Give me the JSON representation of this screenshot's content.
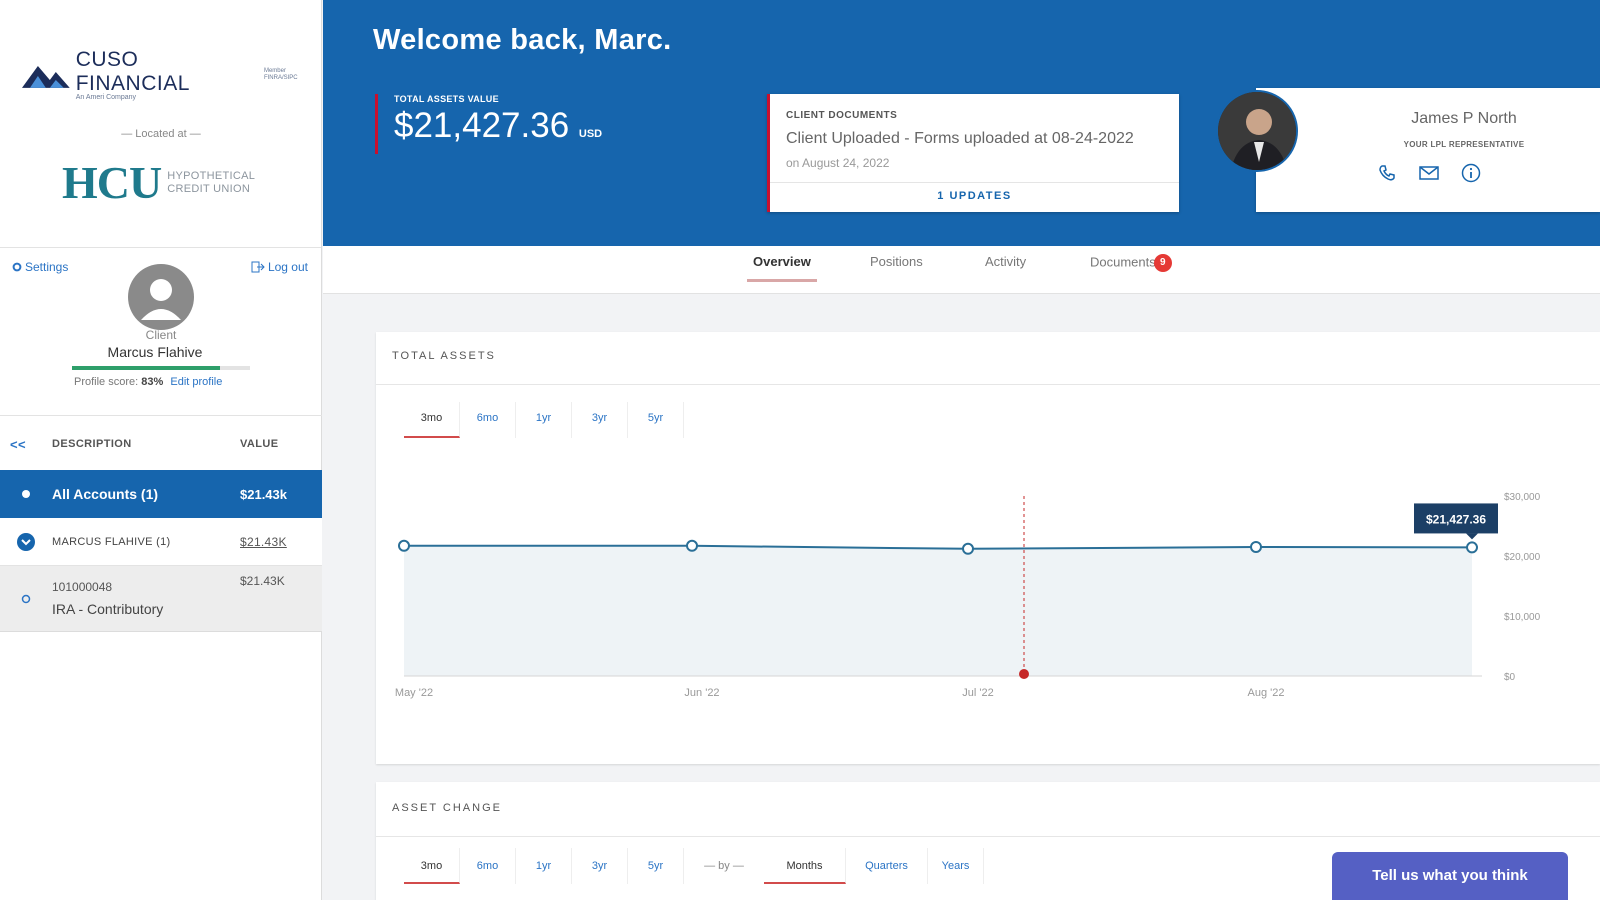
{
  "sidebar": {
    "brand": {
      "name": "CUSO FINANCIAL",
      "sub": "An Ameri Company",
      "side": "Member FINRA/SIPC"
    },
    "located_at": "— Located at —",
    "hcu": {
      "text": "HCU",
      "side_line1": "HYPOTHETICAL",
      "side_line2": "CREDIT UNION"
    },
    "settings_label": "Settings",
    "logout_label": "Log out",
    "profile": {
      "role": "Client",
      "name": "Marcus Flahive",
      "score_label": "Profile score:",
      "score_value": "83%",
      "score_fraction": 0.83,
      "edit_label": "Edit profile"
    },
    "accounts_header": {
      "collapse": "<<",
      "description": "DESCRIPTION",
      "value": "VALUE"
    },
    "accounts": [
      {
        "description": "All Accounts (1)",
        "value": "$21.43k"
      },
      {
        "description": "MARCUS FLAHIVE (1)",
        "value": "$21.43K"
      },
      {
        "number": "101000048",
        "description": "IRA - Contributory",
        "value": "$21.43K"
      }
    ]
  },
  "header": {
    "welcome": "Welcome back, Marc.",
    "total_assets_label": "TOTAL ASSETS VALUE",
    "total_assets_value": "$21,427.36",
    "currency": "USD",
    "client_documents": {
      "label": "CLIENT DOCUMENTS",
      "title": "Client Uploaded - Forms uploaded at 08-24-2022",
      "date": "on August 24, 2022",
      "updates": "1 UPDATES"
    },
    "representative": {
      "name": "James P North",
      "role": "YOUR LPL REPRESENTATIVE",
      "icons": [
        "phone-icon",
        "mail-icon",
        "info-icon"
      ]
    }
  },
  "tabs": [
    {
      "label": "Overview",
      "active": true
    },
    {
      "label": "Positions"
    },
    {
      "label": "Activity"
    },
    {
      "label": "Documents",
      "badge": "9"
    }
  ],
  "total_assets": {
    "title": "TOTAL ASSETS",
    "ranges": [
      "3mo",
      "6mo",
      "1yr",
      "3yr",
      "5yr"
    ],
    "active_range": "3mo",
    "tooltip": "$21,427.36"
  },
  "chart_data": {
    "type": "area",
    "title": "TOTAL ASSETS",
    "x": [
      "May '22",
      "Jun '22",
      "Jul '22",
      "Aug '22",
      "Aug '22 end"
    ],
    "x_tick_labels": [
      "May '22",
      "Jun '22",
      "Jul '22",
      "Aug '22"
    ],
    "values": [
      21700,
      21700,
      21200,
      21500,
      21427.36
    ],
    "y_ticks": [
      "$30,000",
      "$20,000",
      "$10,000",
      "$0"
    ],
    "ylim": [
      0,
      30000
    ],
    "marker_event": {
      "position": "between Jul '22 and Aug '22",
      "color": "#c62828"
    },
    "grid": false,
    "colors": {
      "line": "#2a6f97",
      "fill": "#eef3f6"
    }
  },
  "asset_change": {
    "title": "ASSET CHANGE",
    "ranges": [
      "3mo",
      "6mo",
      "1yr",
      "3yr",
      "5yr"
    ],
    "by_label": "— by —",
    "groupings": [
      "Months",
      "Quarters",
      "Years"
    ]
  },
  "feedback_button": "Tell us what you think",
  "colors": {
    "brand_blue": "#1665ad",
    "accent_red": "#c8102e",
    "feedback": "#5560c4"
  }
}
